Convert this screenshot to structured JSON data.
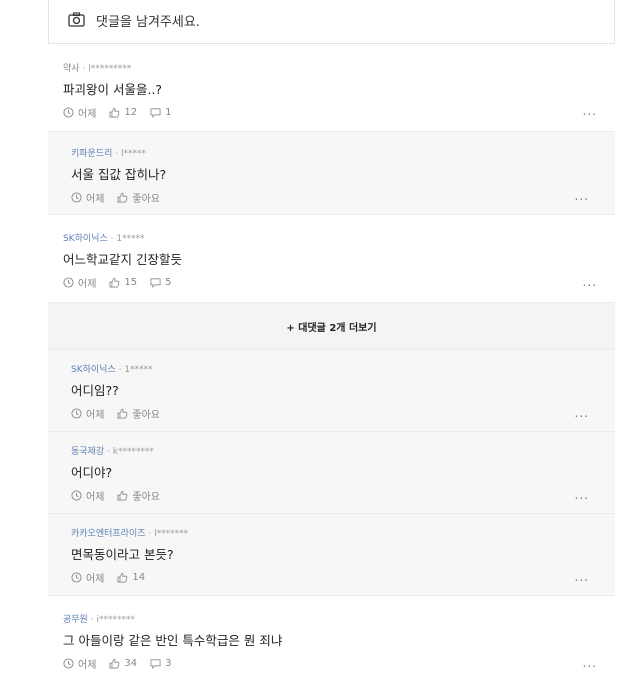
{
  "input": {
    "placeholder": "댓글을 남겨주세요."
  },
  "comments": [
    {
      "nick": "약사",
      "user": "l*********",
      "text": "파괴왕이 서울을..?",
      "time": "어제",
      "likes": "12",
      "replies": "1"
    },
    {
      "nick": "키파운드리",
      "user": "l*****",
      "text": "서울 집값 잡히나?",
      "time": "어제",
      "likes": "좋아요"
    },
    {
      "nick": "SK하이닉스",
      "user": "1*****",
      "text": "어느학교같지 긴장할듯",
      "time": "어제",
      "likes": "15",
      "replies": "5"
    },
    {
      "nick": "SK하이닉스",
      "user": "1*****",
      "text": "어디임??",
      "time": "어제",
      "likes": "좋아요"
    },
    {
      "nick": "동국제강",
      "user": "k********",
      "text": "어디야?",
      "time": "어제",
      "likes": "좋아요"
    },
    {
      "nick": "카카오엔터프라이즈",
      "user": "l*******",
      "text": "면목동이라고 본듯?",
      "time": "어제",
      "likes": "14"
    },
    {
      "nick": "공무원",
      "user": "i********",
      "text": "그 아들이랑 같은 반인 특수학급은 뭔 죄냐",
      "time": "어제",
      "likes": "34",
      "replies": "3"
    }
  ],
  "more_replies": "+ 대댓글 2개 더보기",
  "more_menu": "...",
  "meta_separator": "·"
}
